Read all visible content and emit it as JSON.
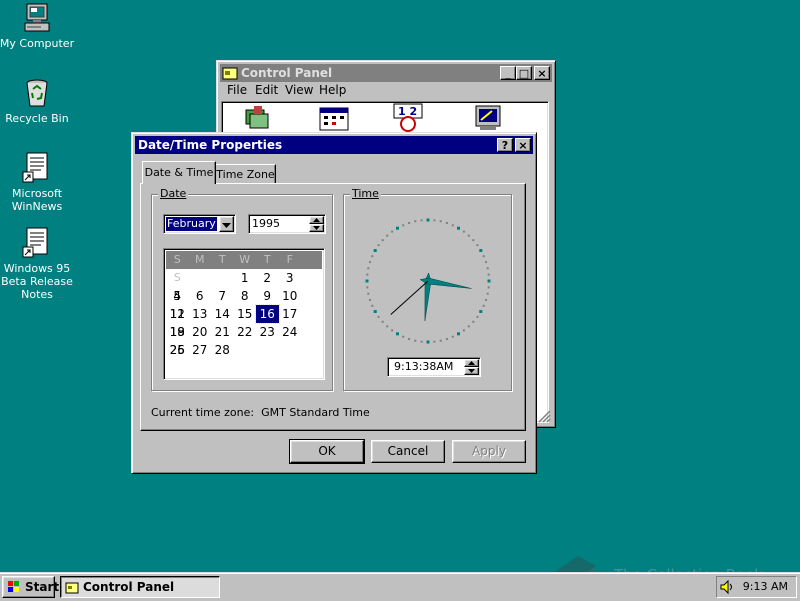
{
  "desktop": {
    "icons": [
      {
        "label": "My Computer"
      },
      {
        "label": "Recycle Bin"
      },
      {
        "label": "Microsoft\nWinNews"
      },
      {
        "label": "Windows 95\nBeta Release\nNotes"
      }
    ]
  },
  "control_panel": {
    "title": "Control Panel",
    "menu": [
      "File",
      "Edit",
      "View",
      "Help"
    ],
    "icons": [
      "display-cpl-icon",
      "datetime-cpl-icon",
      "fonts-cpl-icon",
      "system-cpl-icon"
    ]
  },
  "dialog": {
    "title": "Date/Time Properties",
    "help_button": "?",
    "close_button": "×",
    "tabs": [
      "Date & Time",
      "Time Zone"
    ],
    "date_group_label": "Date",
    "time_group_label": "Time",
    "month": "February",
    "year": "1995",
    "weekday_headers": [
      "S",
      "M",
      "T",
      "W",
      "T",
      "F",
      "S"
    ],
    "calendar_rows": [
      [
        "",
        "",
        "",
        "1",
        "2",
        "3",
        "4"
      ],
      [
        "5",
        "6",
        "7",
        "8",
        "9",
        "10",
        "11"
      ],
      [
        "12",
        "13",
        "14",
        "15",
        "16",
        "17",
        "18"
      ],
      [
        "19",
        "20",
        "21",
        "22",
        "23",
        "24",
        "25"
      ],
      [
        "26",
        "27",
        "28",
        "",
        "",
        "",
        ""
      ]
    ],
    "selected_day": "16",
    "time_value": "9:13:38AM",
    "clock": {
      "hour": 9,
      "minute": 13,
      "second": 38
    },
    "timezone_text": "Current time zone:  GMT Standard Time",
    "buttons": {
      "ok": "OK",
      "cancel": "Cancel",
      "apply": "Apply"
    }
  },
  "taskbar": {
    "start_label": "Start",
    "task_label": "Control Panel",
    "clock": "9:13 AM"
  },
  "watermark": "The Collection Book",
  "colors": {
    "desktop": "#008080",
    "titlebar_active": "#000080",
    "titlebar_inactive": "#808080",
    "face": "#c0c0c0",
    "clock_dots": "#008080"
  }
}
